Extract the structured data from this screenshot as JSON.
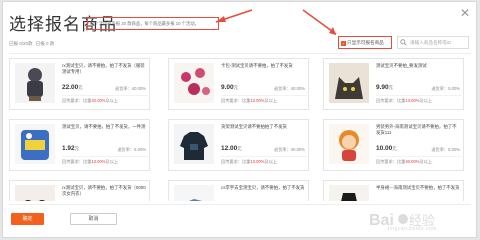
{
  "modal": {
    "title": "选择报名商品",
    "hint": "每个活动最多报 20 款商品，每个商品最多报 10 个活动。",
    "counter": {
      "done": "已报 0/20款",
      "selected": "已报 0 款"
    },
    "only_label": "只显示可报名商品",
    "search_placeholder": "请输入商品名称或ID",
    "ok_label": "确定",
    "cancel_label": "取消"
  },
  "products": [
    {
      "name": "rx测试宝贝，请不要拍，拍了不发货（服装测试专用）",
      "price": "22.00",
      "unit": "元",
      "rate_label": "退货率：",
      "rate": "40.00%",
      "req_prefix": "回传要求：比重",
      "req_value": "40.00%",
      "req_suffix": "及以上",
      "thumb": "figure"
    },
    {
      "name": "卡包-测试宝贝请不要拍，拍了不发货",
      "price": "9.00",
      "unit": "元",
      "rate_label": "退货率：",
      "rate": "40.00%",
      "req_prefix": "回传要求：比重",
      "req_value": "13.00%",
      "req_suffix": "及以上",
      "thumb": "flowers"
    },
    {
      "name": "测试宝贝不要拍_要发测试",
      "price": "9.90",
      "unit": "元",
      "rate_label": "退货率：",
      "rate": "5.00%",
      "req_prefix": "回传要求：比重",
      "req_value": "13.00%",
      "req_suffix": "及以上",
      "thumb": "cat"
    },
    {
      "name": "测试宝贝，请不要拍，拍了不发货，一件测",
      "price": "1.92",
      "unit": "元",
      "rate_label": "退货率：",
      "rate": "5.00%",
      "req_prefix": "回传要求：比重",
      "req_value": "13.00%",
      "req_suffix": "及以上",
      "thumb": "chips"
    },
    {
      "name": "货架测试宝贝请不要拍拍了不发货",
      "price": "12.00",
      "unit": "元",
      "rate_label": "退货率：",
      "rate": "40.00%",
      "req_prefix": "回传要求：比重",
      "req_value": "13.00%",
      "req_suffix": "及以上",
      "thumb": "hoodie"
    },
    {
      "name": "男装男外-海南测试宝贝请不要拍，拍了不发货111",
      "price": "10.00",
      "unit": "元",
      "rate_label": "退货率：",
      "rate": "5.00%",
      "req_prefix": "回传要求：比重",
      "req_value": "40.00%",
      "req_suffix": "及以上",
      "thumb": "doll"
    },
    {
      "name": "rx测试宝贝，请不要拍，拍了不发货（0000次女内衣）",
      "price": "",
      "unit": "",
      "rate_label": "",
      "rate": "",
      "req_prefix": "",
      "req_value": "",
      "req_suffix": "",
      "thumb": "bra"
    },
    {
      "name": "cs李宇去宝测宝贝，请不要拍，拍了不发货",
      "price": "",
      "unit": "",
      "rate_label": "",
      "rate": "",
      "req_prefix": "",
      "req_value": "",
      "req_suffix": "",
      "thumb": "shoes"
    },
    {
      "name": "半身裙---海南测试宝贝不要拍，拍了不发货",
      "price": "",
      "unit": "",
      "rate_label": "",
      "rate": "",
      "req_prefix": "",
      "req_value": "",
      "req_suffix": "",
      "thumb": "skirt"
    }
  ],
  "watermark": {
    "text": "jingyan.baidu.com"
  },
  "colors": {
    "accent": "#f2611d",
    "highlight": "#e74c3c",
    "price_red": "#e4393c"
  }
}
